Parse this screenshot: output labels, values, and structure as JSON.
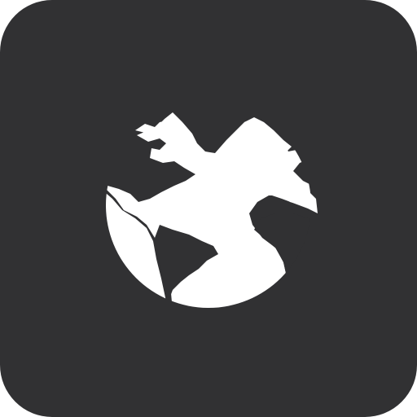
{
  "app_icon": {
    "icon": "globe-icon",
    "colors": {
      "background": "#313133",
      "globe": "#ffffff"
    }
  }
}
